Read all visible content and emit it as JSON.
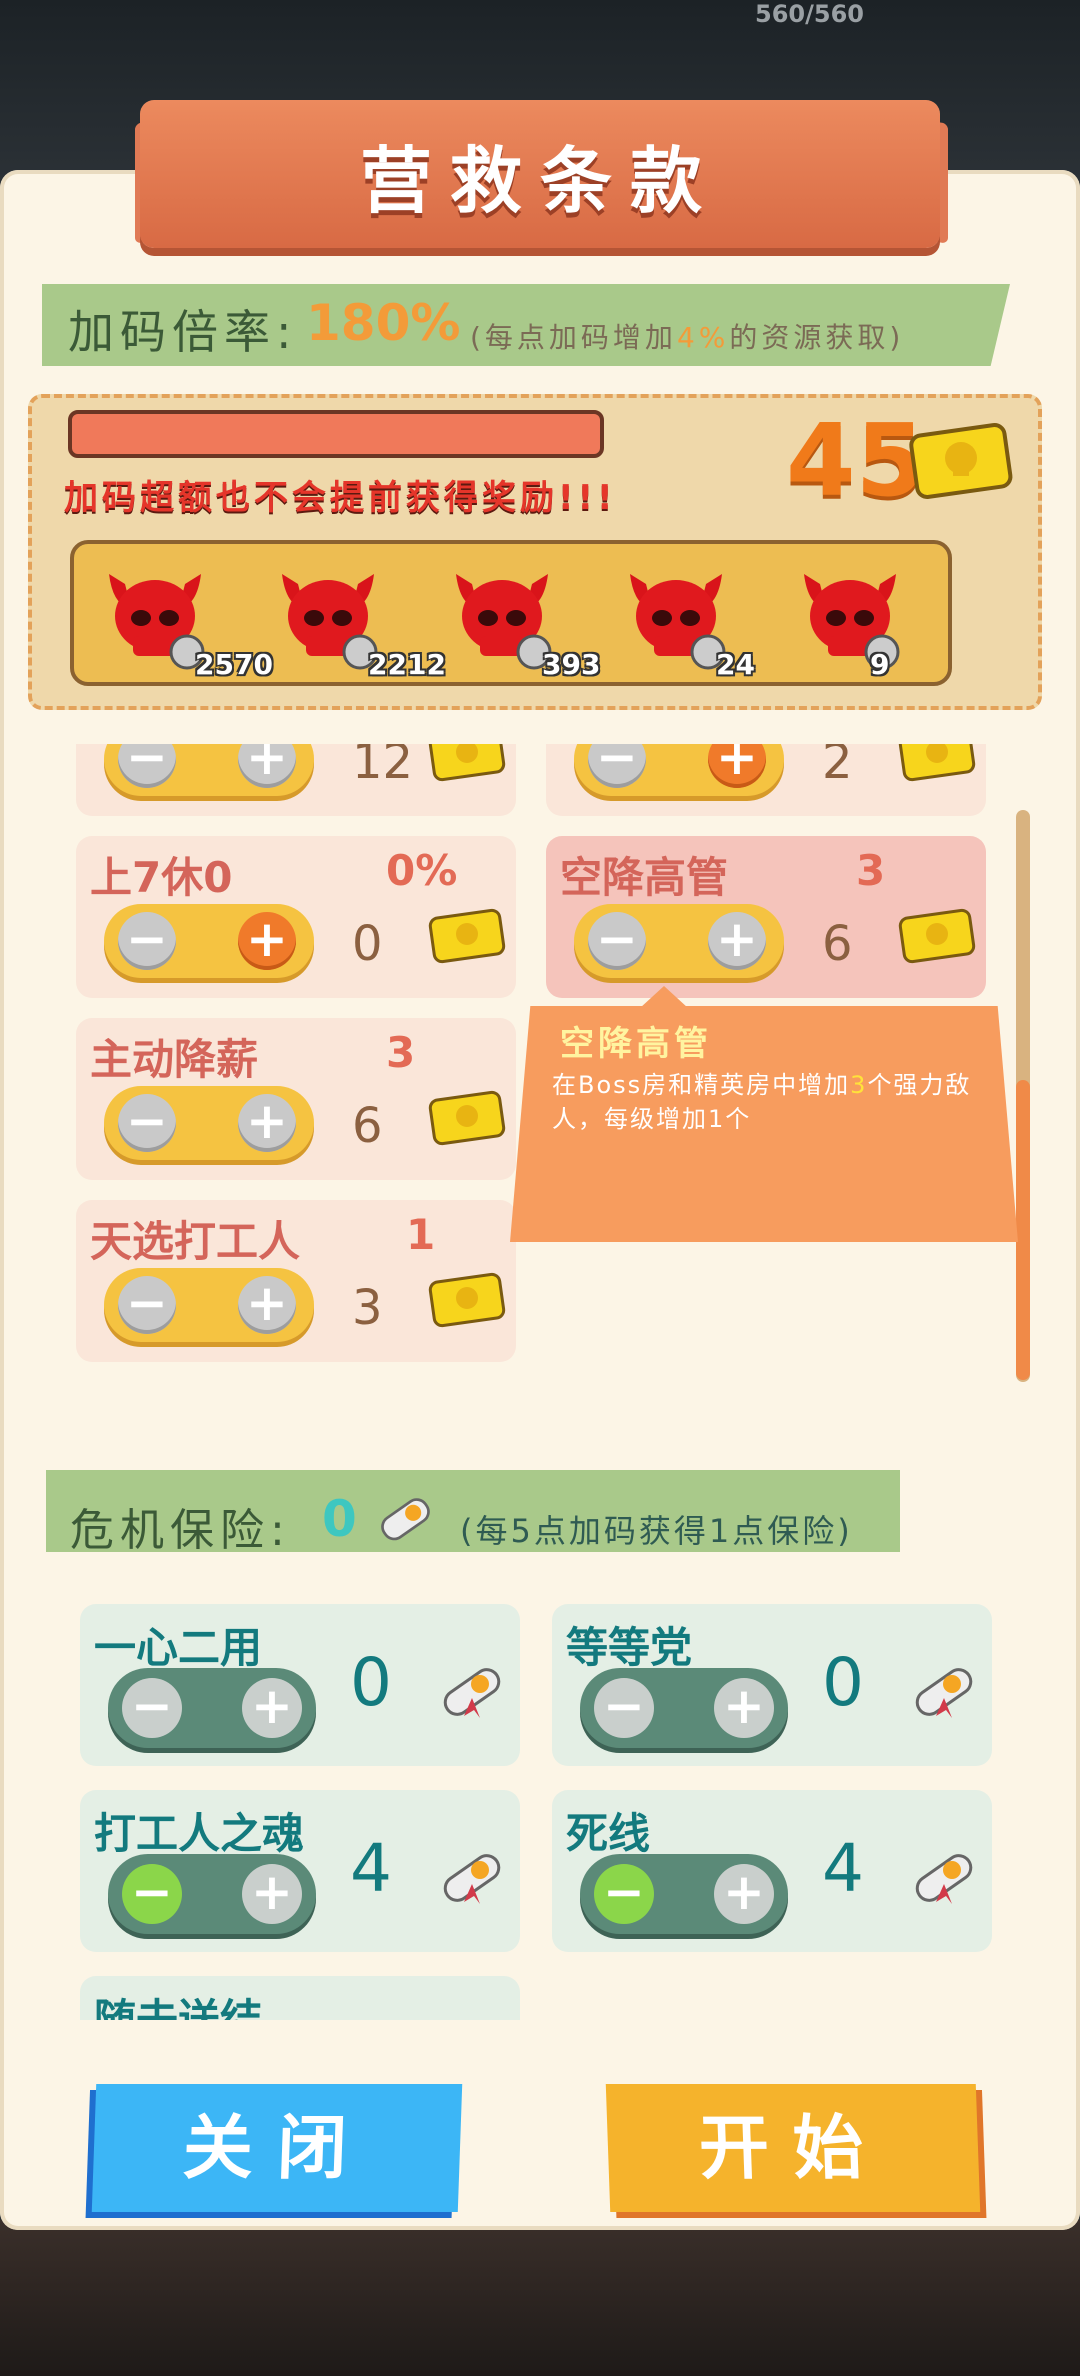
{
  "hud": {
    "hp_text": "560/560"
  },
  "title": "营救条款",
  "multiplier": {
    "label": "加码倍率:",
    "value": "180%",
    "note_prefix": "(每点加码增加",
    "note_highlight": "4%",
    "note_suffix": "的资源获取)"
  },
  "progress": {
    "warning": "加码超额也不会提前获得奖励!!!",
    "cost": "45",
    "rewards": [
      {
        "count": "2570",
        "item_icon": "drum-icon"
      },
      {
        "count": "2212",
        "item_icon": "bolt-icon"
      },
      {
        "count": "393",
        "item_icon": "chip-icon"
      },
      {
        "count": "24",
        "item_icon": "gem-icon"
      },
      {
        "count": "9",
        "item_icon": "crown-icon"
      }
    ]
  },
  "clauses": [
    {
      "name": "",
      "value": "",
      "cost": "12",
      "plus_active": false
    },
    {
      "name": "",
      "value": "",
      "cost": "2",
      "plus_active": true
    },
    {
      "name": "上7休0",
      "value": "0%",
      "cost": "0",
      "plus_active": true
    },
    {
      "name": "空降高管",
      "value": "3",
      "cost": "6",
      "plus_active": false,
      "selected": true
    },
    {
      "name": "主动降薪",
      "value": "3",
      "cost": "6",
      "plus_active": false
    },
    {
      "name": "天选打工人",
      "value": "1",
      "cost": "3",
      "plus_active": false
    }
  ],
  "tooltip": {
    "title": "空降高管",
    "desc_prefix": "在Boss房和精英房中增加",
    "desc_highlight": "3",
    "desc_suffix": "个强力敌人，每级增加1个"
  },
  "insurance": {
    "label": "危机保险:",
    "value": "0",
    "note": "(每5点加码获得1点保险)",
    "items": [
      {
        "name": "一心二用",
        "cost": "0",
        "minus_active": false
      },
      {
        "name": "等等党",
        "cost": "0",
        "minus_active": false
      },
      {
        "name": "打工人之魂",
        "cost": "4",
        "minus_active": true
      },
      {
        "name": "死线",
        "cost": "4",
        "minus_active": true
      },
      {
        "name": "随去送结",
        "cost": "",
        "minus_active": false
      }
    ]
  },
  "buttons": {
    "close": "关闭",
    "start": "开始"
  },
  "colors": {
    "accent_orange": "#f39b39",
    "close_blue": "#3cb6f6",
    "start_yellow": "#f5b32c"
  }
}
